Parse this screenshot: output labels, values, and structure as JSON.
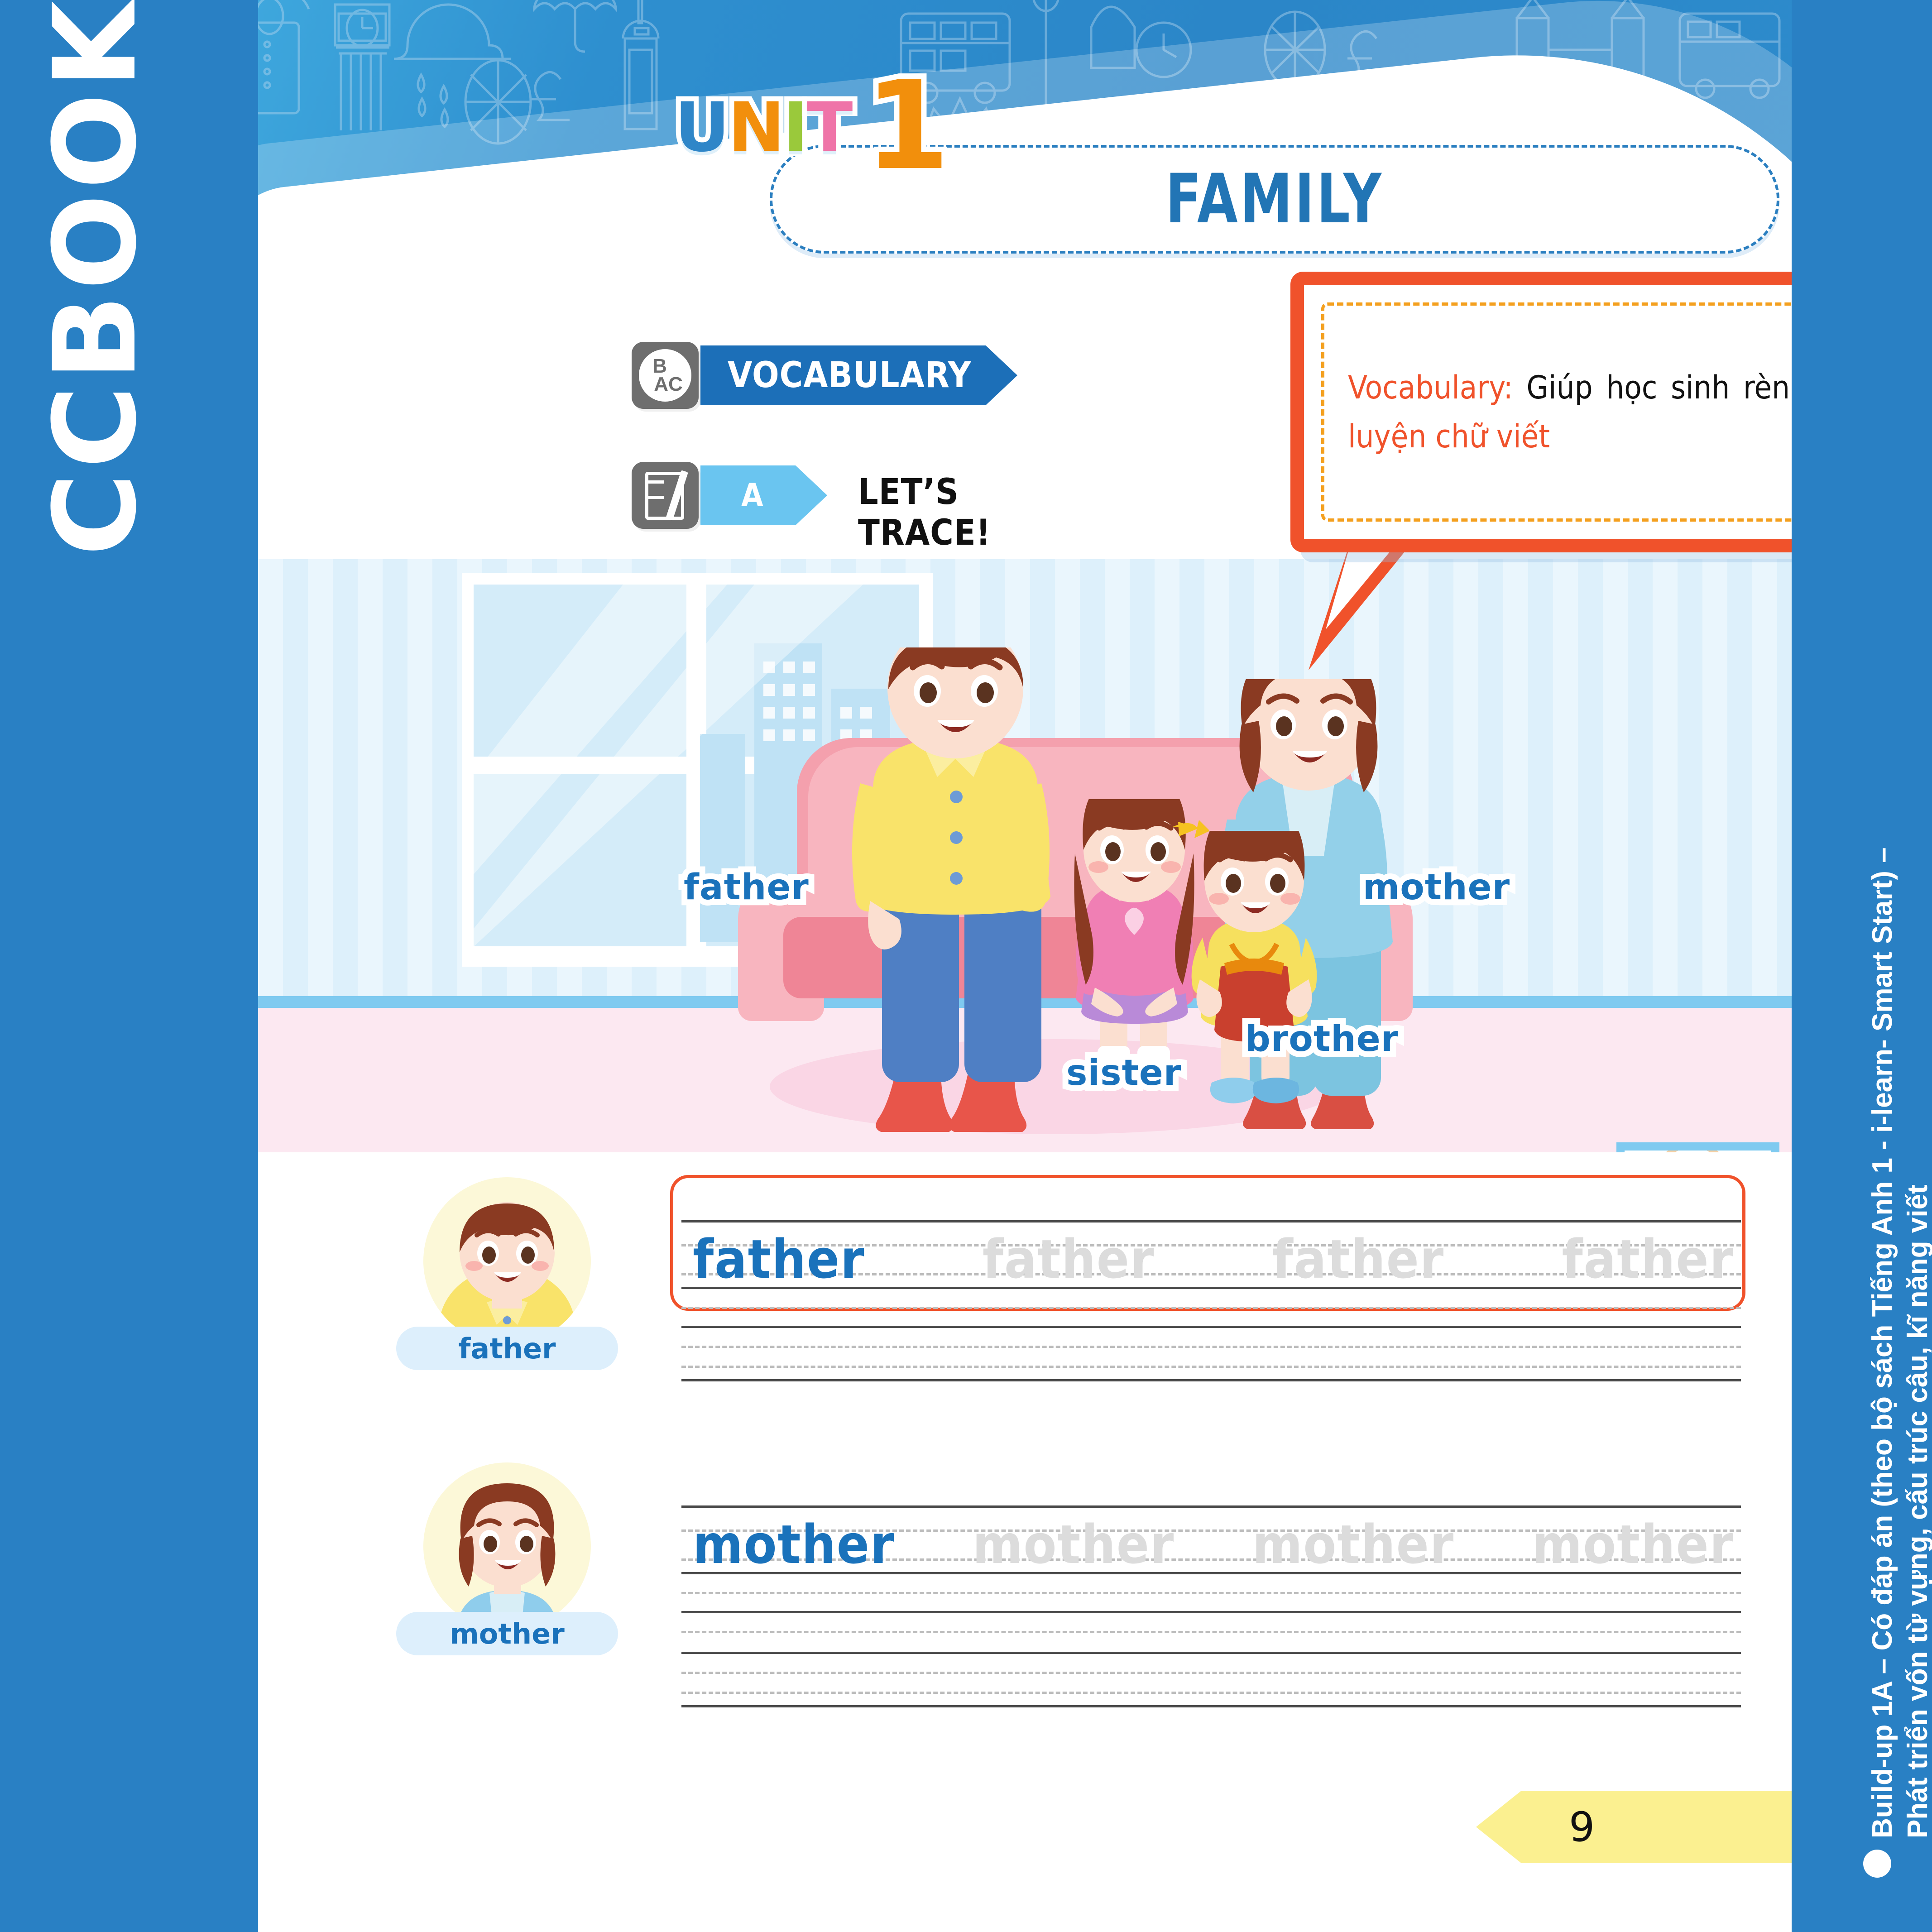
{
  "brand": {
    "logo_text": "CCBOOK"
  },
  "right_rail": {
    "line1": "Build-up 1A – Có đáp án (theo bộ sách Tiếng Anh 1 - i-learn- Smart Start) –",
    "line2": "Phát triển vốn từ vựng, cấu trúc câu, kĩ năng viết"
  },
  "header": {
    "unit_label": "UNIT",
    "unit_letters": [
      "U",
      "N",
      "I",
      "T"
    ],
    "unit_letter_colors": [
      "#2f86c8",
      "#f28f0c",
      "#9ac93b",
      "#ef74a8"
    ],
    "unit_number": "1",
    "title": "FAMILY"
  },
  "sections": [
    {
      "icon": "bac-circle-icon",
      "icon_top": "B",
      "icon_bottom": "AC",
      "label": "VOCABULARY",
      "tab_color": "#1c6fb8"
    },
    {
      "icon": "book-pencil-icon",
      "tab_letter": "A",
      "label": "LET’S TRACE!",
      "tab_color": "#6ac5f0"
    }
  ],
  "callout": {
    "part1": "Vocabulary:",
    "part2": "Giúp học sinh rèn ",
    "part3": "luyện chữ viết",
    "accent_color": "#f0522b",
    "dash_color": "#f4a01f"
  },
  "scene": {
    "labels": [
      {
        "text": "father",
        "name": "scene-label-father"
      },
      {
        "text": "mother",
        "name": "scene-label-mother"
      },
      {
        "text": "sister",
        "name": "scene-label-sister"
      },
      {
        "text": "brother",
        "name": "scene-label-brother"
      }
    ]
  },
  "trace_rows": [
    {
      "avatar_label": "father",
      "word": "father",
      "ghosts": [
        "father",
        "father",
        "father"
      ]
    },
    {
      "avatar_label": "mother",
      "word": "mother",
      "ghosts": [
        "mother",
        "mother",
        "mother"
      ]
    }
  ],
  "footer": {
    "page_number": "9"
  },
  "colors": {
    "brand_blue": "#2980c4",
    "title_blue": "#2275b5",
    "word_blue": "#1a72bb",
    "orange": "#f0522b",
    "ghost_gray": "#dcdcdc",
    "page_tag_yellow": "#fbf090"
  }
}
